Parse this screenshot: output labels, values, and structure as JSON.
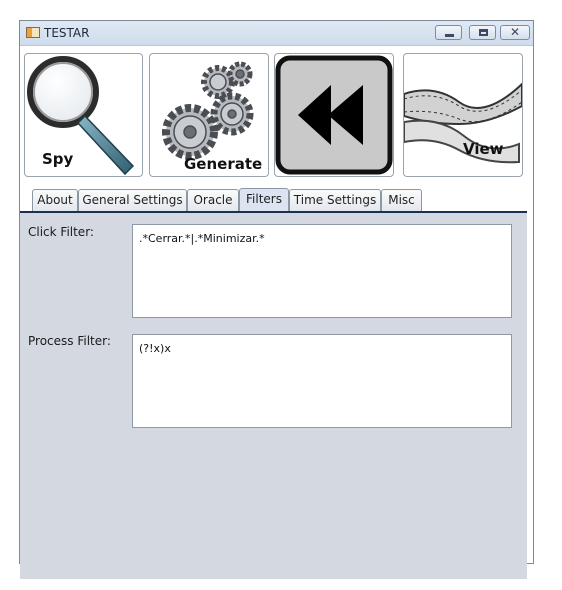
{
  "window": {
    "title": "TESTAR",
    "controls": {
      "minimize": "minimize-icon",
      "maximize": "maximize-icon",
      "close": "close-icon"
    }
  },
  "toolbar": {
    "buttons": [
      {
        "label": "Spy",
        "icon": "magnifier-icon"
      },
      {
        "label": "Generate",
        "icon": "gears-icon"
      },
      {
        "label": "",
        "icon": "rewind-icon"
      },
      {
        "label": "View",
        "icon": "film-strip-icon"
      }
    ]
  },
  "tabs": [
    {
      "label": "About",
      "active": false
    },
    {
      "label": "General Settings",
      "active": false
    },
    {
      "label": "Oracle",
      "active": false
    },
    {
      "label": "Filters",
      "active": true
    },
    {
      "label": "Time Settings",
      "active": false
    },
    {
      "label": "Misc",
      "active": false
    }
  ],
  "filters": {
    "click_filter": {
      "label": "Click Filter:",
      "value": ".*Cerrar.*|.*Minimizar.*"
    },
    "process_filter": {
      "label": "Process Filter:",
      "value": "(?!x)x"
    }
  },
  "colors": {
    "panel_background": "#d4d9e1",
    "active_tab": "#dbe4f0",
    "tab_rule": "#1e2f55"
  }
}
